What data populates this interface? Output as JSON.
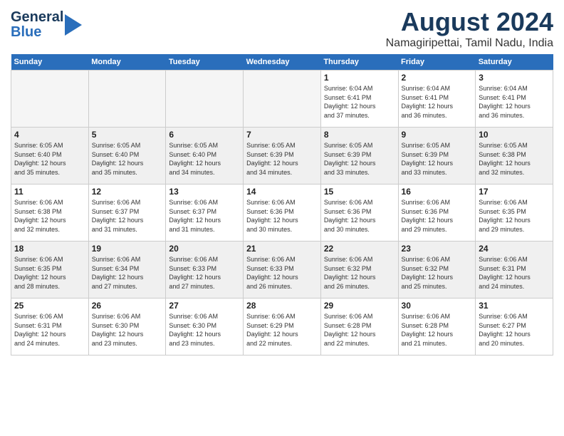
{
  "header": {
    "logo_general": "General",
    "logo_blue": "Blue",
    "month": "August 2024",
    "location": "Namagiripettai, Tamil Nadu, India"
  },
  "weekdays": [
    "Sunday",
    "Monday",
    "Tuesday",
    "Wednesday",
    "Thursday",
    "Friday",
    "Saturday"
  ],
  "weeks": [
    [
      {
        "day": "",
        "info": ""
      },
      {
        "day": "",
        "info": ""
      },
      {
        "day": "",
        "info": ""
      },
      {
        "day": "",
        "info": ""
      },
      {
        "day": "1",
        "info": "Sunrise: 6:04 AM\nSunset: 6:41 PM\nDaylight: 12 hours\nand 37 minutes."
      },
      {
        "day": "2",
        "info": "Sunrise: 6:04 AM\nSunset: 6:41 PM\nDaylight: 12 hours\nand 36 minutes."
      },
      {
        "day": "3",
        "info": "Sunrise: 6:04 AM\nSunset: 6:41 PM\nDaylight: 12 hours\nand 36 minutes."
      }
    ],
    [
      {
        "day": "4",
        "info": "Sunrise: 6:05 AM\nSunset: 6:40 PM\nDaylight: 12 hours\nand 35 minutes."
      },
      {
        "day": "5",
        "info": "Sunrise: 6:05 AM\nSunset: 6:40 PM\nDaylight: 12 hours\nand 35 minutes."
      },
      {
        "day": "6",
        "info": "Sunrise: 6:05 AM\nSunset: 6:40 PM\nDaylight: 12 hours\nand 34 minutes."
      },
      {
        "day": "7",
        "info": "Sunrise: 6:05 AM\nSunset: 6:39 PM\nDaylight: 12 hours\nand 34 minutes."
      },
      {
        "day": "8",
        "info": "Sunrise: 6:05 AM\nSunset: 6:39 PM\nDaylight: 12 hours\nand 33 minutes."
      },
      {
        "day": "9",
        "info": "Sunrise: 6:05 AM\nSunset: 6:39 PM\nDaylight: 12 hours\nand 33 minutes."
      },
      {
        "day": "10",
        "info": "Sunrise: 6:05 AM\nSunset: 6:38 PM\nDaylight: 12 hours\nand 32 minutes."
      }
    ],
    [
      {
        "day": "11",
        "info": "Sunrise: 6:06 AM\nSunset: 6:38 PM\nDaylight: 12 hours\nand 32 minutes."
      },
      {
        "day": "12",
        "info": "Sunrise: 6:06 AM\nSunset: 6:37 PM\nDaylight: 12 hours\nand 31 minutes."
      },
      {
        "day": "13",
        "info": "Sunrise: 6:06 AM\nSunset: 6:37 PM\nDaylight: 12 hours\nand 31 minutes."
      },
      {
        "day": "14",
        "info": "Sunrise: 6:06 AM\nSunset: 6:36 PM\nDaylight: 12 hours\nand 30 minutes."
      },
      {
        "day": "15",
        "info": "Sunrise: 6:06 AM\nSunset: 6:36 PM\nDaylight: 12 hours\nand 30 minutes."
      },
      {
        "day": "16",
        "info": "Sunrise: 6:06 AM\nSunset: 6:36 PM\nDaylight: 12 hours\nand 29 minutes."
      },
      {
        "day": "17",
        "info": "Sunrise: 6:06 AM\nSunset: 6:35 PM\nDaylight: 12 hours\nand 29 minutes."
      }
    ],
    [
      {
        "day": "18",
        "info": "Sunrise: 6:06 AM\nSunset: 6:35 PM\nDaylight: 12 hours\nand 28 minutes."
      },
      {
        "day": "19",
        "info": "Sunrise: 6:06 AM\nSunset: 6:34 PM\nDaylight: 12 hours\nand 27 minutes."
      },
      {
        "day": "20",
        "info": "Sunrise: 6:06 AM\nSunset: 6:33 PM\nDaylight: 12 hours\nand 27 minutes."
      },
      {
        "day": "21",
        "info": "Sunrise: 6:06 AM\nSunset: 6:33 PM\nDaylight: 12 hours\nand 26 minutes."
      },
      {
        "day": "22",
        "info": "Sunrise: 6:06 AM\nSunset: 6:32 PM\nDaylight: 12 hours\nand 26 minutes."
      },
      {
        "day": "23",
        "info": "Sunrise: 6:06 AM\nSunset: 6:32 PM\nDaylight: 12 hours\nand 25 minutes."
      },
      {
        "day": "24",
        "info": "Sunrise: 6:06 AM\nSunset: 6:31 PM\nDaylight: 12 hours\nand 24 minutes."
      }
    ],
    [
      {
        "day": "25",
        "info": "Sunrise: 6:06 AM\nSunset: 6:31 PM\nDaylight: 12 hours\nand 24 minutes."
      },
      {
        "day": "26",
        "info": "Sunrise: 6:06 AM\nSunset: 6:30 PM\nDaylight: 12 hours\nand 23 minutes."
      },
      {
        "day": "27",
        "info": "Sunrise: 6:06 AM\nSunset: 6:30 PM\nDaylight: 12 hours\nand 23 minutes."
      },
      {
        "day": "28",
        "info": "Sunrise: 6:06 AM\nSunset: 6:29 PM\nDaylight: 12 hours\nand 22 minutes."
      },
      {
        "day": "29",
        "info": "Sunrise: 6:06 AM\nSunset: 6:28 PM\nDaylight: 12 hours\nand 22 minutes."
      },
      {
        "day": "30",
        "info": "Sunrise: 6:06 AM\nSunset: 6:28 PM\nDaylight: 12 hours\nand 21 minutes."
      },
      {
        "day": "31",
        "info": "Sunrise: 6:06 AM\nSunset: 6:27 PM\nDaylight: 12 hours\nand 20 minutes."
      }
    ]
  ]
}
